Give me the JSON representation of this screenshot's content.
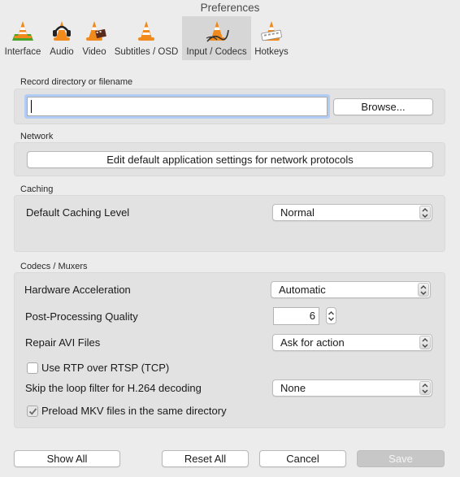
{
  "window": {
    "title": "Preferences"
  },
  "toolbar": {
    "items": [
      {
        "label": "Interface",
        "icon": "interface-cone-icon"
      },
      {
        "label": "Audio",
        "icon": "audio-cone-icon"
      },
      {
        "label": "Video",
        "icon": "video-cone-icon"
      },
      {
        "label": "Subtitles / OSD",
        "icon": "subtitles-cone-icon"
      },
      {
        "label": "Input / Codecs",
        "icon": "input-codecs-cone-icon",
        "active": true
      },
      {
        "label": "Hotkeys",
        "icon": "hotkeys-cone-icon"
      }
    ]
  },
  "record": {
    "section_title": "Record directory or filename",
    "field_value": "",
    "browse_label": "Browse..."
  },
  "network": {
    "section_title": "Network",
    "edit_button_label": "Edit default application settings for network protocols"
  },
  "caching": {
    "section_title": "Caching",
    "level_label": "Default Caching Level",
    "level_value": "Normal"
  },
  "codecs": {
    "section_title": "Codecs / Muxers",
    "hw_accel_label": "Hardware Acceleration",
    "hw_accel_value": "Automatic",
    "pp_quality_label": "Post-Processing Quality",
    "pp_quality_value": "6",
    "repair_avi_label": "Repair AVI Files",
    "repair_avi_value": "Ask for action",
    "rtp_label": "Use RTP over RTSP (TCP)",
    "rtp_checked": false,
    "skip_loop_label": "Skip the loop filter for H.264 decoding",
    "skip_loop_value": "None",
    "preload_mkv_label": "Preload MKV files in the same directory",
    "preload_mkv_checked": true
  },
  "footer": {
    "show_all_label": "Show All",
    "reset_all_label": "Reset All",
    "cancel_label": "Cancel",
    "save_label": "Save"
  },
  "colors": {
    "window_bg": "#ececec",
    "group_bg": "#e2e2e2",
    "active_tab_bg": "#d6d6d6",
    "focus_ring": "#b1cdf5",
    "cone_orange": "#f08a1c"
  }
}
